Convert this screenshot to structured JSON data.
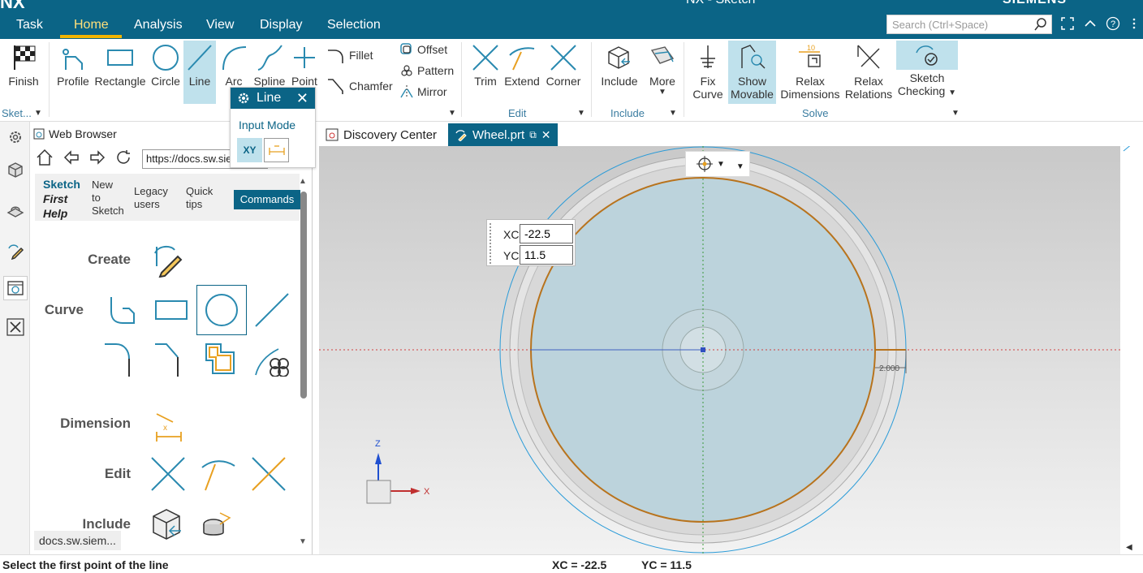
{
  "app": {
    "logo": "NX",
    "title": "NX - Sketch",
    "brand": "SIEMENS"
  },
  "menu": {
    "tabs": [
      {
        "label": "Task"
      },
      {
        "label": "Home"
      },
      {
        "label": "Analysis"
      },
      {
        "label": "View"
      },
      {
        "label": "Display"
      },
      {
        "label": "Selection"
      }
    ],
    "active_tab": "Home",
    "search_placeholder": "Search (Ctrl+Space)"
  },
  "ribbon": {
    "finish": "Finish",
    "sketch_group": "Sket...",
    "curve_buttons": [
      {
        "label": "Profile"
      },
      {
        "label": "Rectangle"
      },
      {
        "label": "Circle"
      },
      {
        "label": "Line"
      },
      {
        "label": "Arc"
      },
      {
        "label": "Spline"
      },
      {
        "label": "Point"
      }
    ],
    "fillet": "Fillet",
    "chamfer": "Chamfer",
    "offset": "Offset",
    "pattern": "Pattern",
    "mirror": "Mirror",
    "edit_buttons": [
      {
        "label": "Trim"
      },
      {
        "label": "Extend"
      },
      {
        "label": "Corner"
      }
    ],
    "edit_group": "Edit",
    "include": "Include",
    "more": "More",
    "include_group": "Include",
    "fix_curve": [
      "Fix",
      "Curve"
    ],
    "show_movable": [
      "Show",
      "Movable"
    ],
    "relax_dimensions": [
      "Relax",
      "Dimensions"
    ],
    "relax_relations": [
      "Relax",
      "Relations"
    ],
    "sketch_checking": [
      "Sketch",
      "Checking"
    ],
    "solve_group": "Solve"
  },
  "line_dialog": {
    "title": "Line",
    "input_mode_label": "Input Mode",
    "mode_xy": "XY"
  },
  "web_browser": {
    "title": "Web Browser",
    "url": "https://docs.sw.siemens.com",
    "nav": {
      "sketch": "Sketch",
      "first_help": "First",
      "help": "Help",
      "new_to_sketch": [
        "New",
        "to",
        "Sketch"
      ],
      "legacy_users": [
        "Legacy",
        "users"
      ],
      "quick_tips": [
        "Quick",
        "tips"
      ],
      "commands": "Commands"
    },
    "sections": {
      "create": "Create",
      "curve": "Curve",
      "dimension": "Dimension",
      "edit": "Edit",
      "include": "Include"
    },
    "status": "docs.sw.siem..."
  },
  "doc_tabs": [
    {
      "label": "Discovery Center"
    },
    {
      "label": "Wheel.prt"
    }
  ],
  "coord_input": {
    "xc_label": "XC",
    "xc_value": "-22.5",
    "yc_label": "YC",
    "yc_value": "11.5"
  },
  "viewport": {
    "dimension_label": "2.000",
    "triad_z": "Z",
    "triad_x": "X"
  },
  "status_bar": {
    "message": "Select the first point of the line",
    "xc": "XC = -22.5",
    "yc": "YC = 11.5"
  },
  "colors": {
    "brand": "#0b6486",
    "accent": "#f0b400",
    "selected": "#bfe1ec",
    "curve": "#b8731d"
  }
}
